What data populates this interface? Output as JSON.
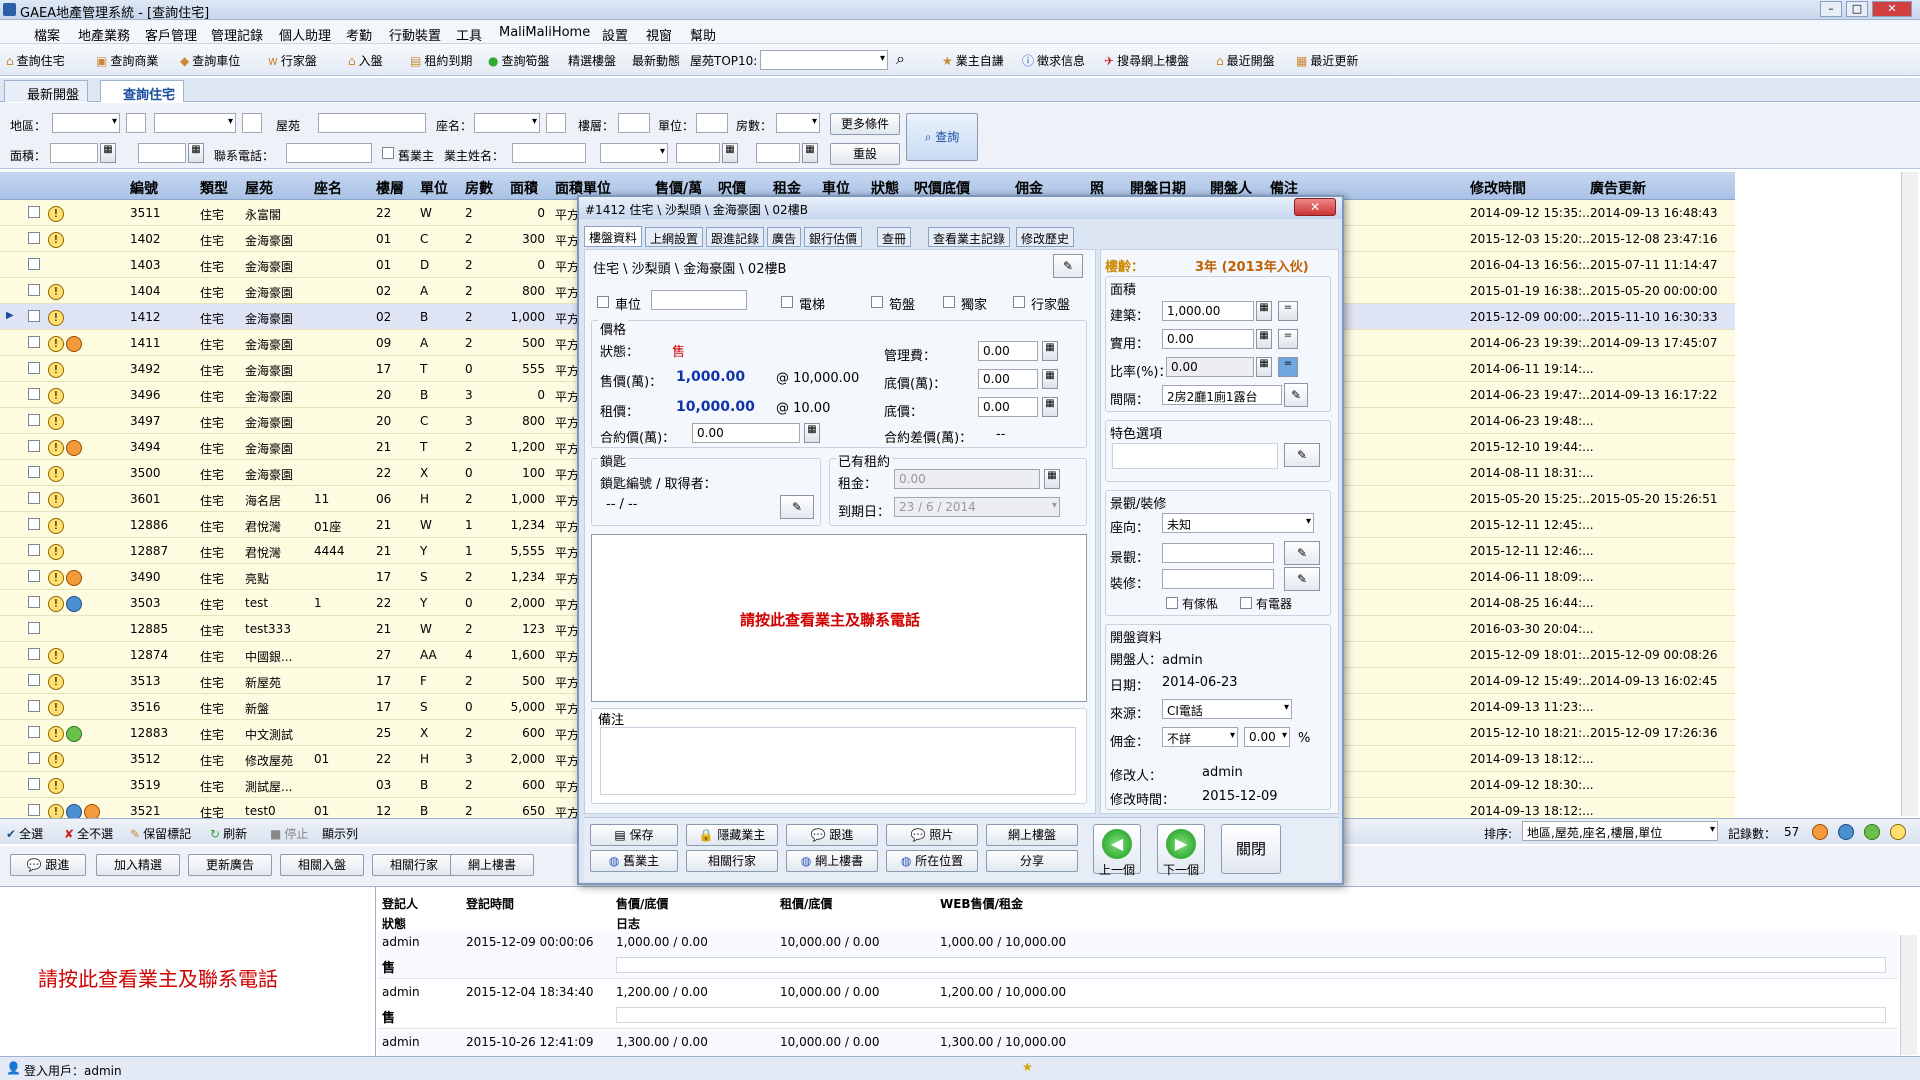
{
  "window": {
    "title": "GAEA地產管理系統 - [查詢住宅]"
  },
  "menu": [
    "檔案",
    "地產業務",
    "客戶管理",
    "管理記錄",
    "個人助理",
    "考勤",
    "行動裝置",
    "工具",
    "MaliMaliHome",
    "設置",
    "視窗",
    "幫助"
  ],
  "toolbar": [
    "查詢住宅",
    "查詢商業",
    "查詢車位",
    "行家盤",
    "入盤",
    "租約到期",
    "查詢筍盤",
    "精選樓盤",
    "最新動態",
    "屋苑TOP10:",
    "業主自謙",
    "徵求信息",
    "搜尋網上樓盤",
    "最近開盤",
    "最近更新"
  ],
  "tabs": [
    "最新開盤",
    "查詢住宅"
  ],
  "filter": {
    "area": "地區：",
    "estate": "屋苑",
    "block": "座名：",
    "floor": "樓層：",
    "unit": "單位：",
    "rooms": "房數：",
    "more": "更多條件",
    "search": "查詢",
    "size": "面積：",
    "owner_phone": "聯系電話：",
    "old_owner": "舊業主",
    "owner_name": "業主姓名：",
    "reset": "重設"
  },
  "grid": {
    "headers": [
      "編號",
      "類型",
      "屋苑",
      "座名",
      "樓層",
      "單位",
      "房數",
      "面積",
      "面積單位",
      "售價/萬",
      "呎價",
      "租金",
      "車位",
      "狀態",
      "呎價底價",
      "佣金",
      "照",
      "開盤日期",
      "開盤人",
      "備注",
      "修改時間",
      "廣告更新"
    ],
    "rows": [
      [
        "3511",
        "住宅",
        "永富閣",
        "",
        "22",
        "W",
        "2",
        "0",
        "平方",
        "2014-09-12 15:35:...",
        "2014-09-13 16:48:43"
      ],
      [
        "1402",
        "住宅",
        "金海豪園",
        "",
        "01",
        "C",
        "2",
        "300",
        "平方",
        "2015-12-03 15:20:...",
        "2015-12-08 23:47:16"
      ],
      [
        "1403",
        "住宅",
        "金海豪園",
        "",
        "01",
        "D",
        "2",
        "0",
        "平方",
        "2016-04-13 16:56:...",
        "2015-07-11 11:14:47"
      ],
      [
        "1404",
        "住宅",
        "金海豪園",
        "",
        "02",
        "A",
        "2",
        "800",
        "平方",
        "2015-01-19 16:38:...",
        "2015-05-20 00:00:00"
      ],
      [
        "1412",
        "住宅",
        "金海豪園",
        "",
        "02",
        "B",
        "2",
        "1,000",
        "平方",
        "2015-12-09 00:00:...",
        "2015-11-10 16:30:33"
      ],
      [
        "1411",
        "住宅",
        "金海豪園",
        "",
        "09",
        "A",
        "2",
        "500",
        "平方",
        "2014-06-23 19:39:...",
        "2014-09-13 17:45:07"
      ],
      [
        "3492",
        "住宅",
        "金海豪園",
        "",
        "17",
        "T",
        "0",
        "555",
        "平方",
        "2014-06-11 19:14:...",
        ""
      ],
      [
        "3496",
        "住宅",
        "金海豪園",
        "",
        "20",
        "B",
        "3",
        "0",
        "平方",
        "2014-06-23 19:47:...",
        "2014-09-13 16:17:22"
      ],
      [
        "3497",
        "住宅",
        "金海豪園",
        "",
        "20",
        "C",
        "3",
        "800",
        "平方",
        "2014-06-23 19:48:...",
        ""
      ],
      [
        "3494",
        "住宅",
        "金海豪園",
        "",
        "21",
        "T",
        "2",
        "1,200",
        "平方",
        "2015-12-10 19:44:...",
        ""
      ],
      [
        "3500",
        "住宅",
        "金海豪園",
        "",
        "22",
        "X",
        "0",
        "100",
        "平方",
        "2014-08-11 18:31:...",
        ""
      ],
      [
        "3601",
        "住宅",
        "海名居",
        "11",
        "06",
        "H",
        "2",
        "1,000",
        "平方",
        "2015-05-20 15:25:...",
        "2015-05-20 15:26:51"
      ],
      [
        "12886",
        "住宅",
        "君悅灣",
        "01座",
        "21",
        "W",
        "1",
        "1,234",
        "平方",
        "2015-12-11 12:45:...",
        ""
      ],
      [
        "12887",
        "住宅",
        "君悅灣",
        "4444",
        "21",
        "Y",
        "1",
        "5,555",
        "平方",
        "2015-12-11 12:46:...",
        ""
      ],
      [
        "3490",
        "住宅",
        "亮點",
        "",
        "17",
        "S",
        "2",
        "1,234",
        "平方",
        "2014-06-11 18:09:...",
        ""
      ],
      [
        "3503",
        "住宅",
        "test",
        "1",
        "22",
        "Y",
        "0",
        "2,000",
        "平方",
        "2014-08-25 16:44:...",
        ""
      ],
      [
        "12885",
        "住宅",
        "test333",
        "",
        "21",
        "W",
        "2",
        "123",
        "平方",
        "2016-03-30 20:04:...",
        ""
      ],
      [
        "12874",
        "住宅",
        "中國銀...",
        "",
        "27",
        "AA",
        "4",
        "1,600",
        "平方",
        "2015-12-09 18:01:...",
        "2015-12-09 00:08:26"
      ],
      [
        "3513",
        "住宅",
        "新屋苑",
        "",
        "17",
        "F",
        "2",
        "500",
        "平方",
        "2014-09-12 15:49:...",
        "2014-09-13 16:02:45"
      ],
      [
        "3516",
        "住宅",
        "新盤",
        "",
        "17",
        "S",
        "0",
        "5,000",
        "平方",
        "2014-09-13 11:23:...",
        ""
      ],
      [
        "12883",
        "住宅",
        "中文測試",
        "",
        "25",
        "X",
        "2",
        "600",
        "平方",
        "2015-12-10 18:21:...",
        "2015-12-09 17:26:36"
      ],
      [
        "3512",
        "住宅",
        "修改屋苑",
        "01",
        "22",
        "H",
        "3",
        "2,000",
        "平方",
        "2014-09-13 18:12:...",
        ""
      ],
      [
        "3519",
        "住宅",
        "測試屋...",
        "",
        "03",
        "B",
        "2",
        "600",
        "平方",
        "2014-09-12 18:30:...",
        ""
      ],
      [
        "3521",
        "住宅",
        "test0",
        "01",
        "12",
        "B",
        "2",
        "650",
        "平方",
        "2014-09-13 18:12:...",
        ""
      ]
    ]
  },
  "bottombar": {
    "select_all": "全選",
    "select_none": "全不選",
    "keep": "保留標記",
    "refresh": "刷新",
    "stop": "停止",
    "show": "顯示列",
    "sort_label": "排序:",
    "sort_value": "地區,屋苑,座名,樓層,單位",
    "count_label": "記錄數：",
    "count": "57"
  },
  "actions": [
    "跟進",
    "加入精選",
    "更新廣告",
    "相關入盤",
    "相關行家",
    "網上樓書"
  ],
  "lower": {
    "notice": "請按此查看業主及聯系電話",
    "cols": [
      "登記人",
      "登記時間",
      "售價/底價",
      "租價/底價",
      "WEB售價/租金"
    ],
    "sub": [
      "狀態",
      "日志"
    ],
    "rows": [
      [
        "admin",
        "2015-12-09 00:00:06",
        "1,000.00 / 0.00",
        "10,000.00 / 0.00",
        "1,000.00 / 10,000.00",
        "售"
      ],
      [
        "admin",
        "2015-12-04 18:34:40",
        "1,200.00 / 0.00",
        "10,000.00 / 0.00",
        "1,200.00 / 10,000.00",
        "售"
      ],
      [
        "admin",
        "2015-10-26 12:41:09",
        "1,300.00 / 0.00",
        "10,000.00 / 0.00",
        "1,300.00 / 10,000.00",
        ""
      ]
    ]
  },
  "status": {
    "user": "登入用戶：admin"
  },
  "dialog": {
    "title": "#1412 住宅 \\ 沙梨頭 \\ 金海豪園 \\ 02樓B",
    "close": "✕",
    "tabs": [
      "樓盤資料",
      "上網設置",
      "跟進記錄",
      "廣告",
      "銀行估價",
      "查冊",
      "查看業主記錄",
      "修改歷史"
    ],
    "path": "住宅 \\ 沙梨頭 \\ 金海豪園 \\ 02樓B",
    "checks": {
      "parking": "車位",
      "lift": "電梯",
      "bargain": "筍盤",
      "exclusive": "獨家",
      "agency": "行家盤"
    },
    "price": {
      "legend": "價格",
      "status_label": "狀態：",
      "status": "售",
      "sale_label": "售價(萬)：",
      "sale": "1,000.00",
      "sale_unit": "@ 10,000.00",
      "rent_label": "租價：",
      "rent": "10,000.00",
      "rent_unit": "@ 10.00",
      "contract_label": "合約價(萬)：",
      "contract": "0.00",
      "mgmt_label": "管理費：",
      "mgmt": "0.00",
      "floor_label": "底價(萬)：",
      "floor": "0.00",
      "floor2_label": "底價：",
      "floor2": "0.00",
      "diff_label": "合約差價(萬)：",
      "diff": "--"
    },
    "keys": {
      "legend": "鎖匙",
      "label": "鎖匙編號 / 取得者：",
      "value": "-- / --"
    },
    "lease": {
      "legend": "已有租約",
      "rent_label": "租金：",
      "rent": "0.00",
      "due_label": "到期日：",
      "due": "23 / 6 / 2014"
    },
    "notice": "請按此查看業主及聯系電話",
    "remark": "備注",
    "age_label": "樓齡：",
    "age": "3年 (2013年入伙)",
    "area": {
      "legend": "面積",
      "build_label": "建築：",
      "build": "1,000.00",
      "use_label": "實用：",
      "use": "0.00",
      "ratio_label": "比率(%)：",
      "ratio": "0.00",
      "layout_label": "間隔：",
      "layout": "2房2廳1廁1露台"
    },
    "feature": "特色選項",
    "view": {
      "legend": "景觀/裝修",
      "facing_label": "座向：",
      "facing": "未知",
      "view_label": "景觀：",
      "deco_label": "裝修：",
      "furniture": "有傢俬",
      "appliance": "有電器"
    },
    "open": {
      "legend": "開盤資料",
      "by": "開盤人：admin",
      "date_label": "日期：",
      "date": "2014-06-23",
      "src_label": "來源：",
      "src": "CI電話",
      "comm_label": "佣金：",
      "comm": "不詳",
      "comm2": "0.00",
      "pct": "%",
      "mod_by_label": "修改人：",
      "mod_by": "admin",
      "mod_time_label": "修改時間：",
      "mod_time": "2015-12-09"
    },
    "buttons": [
      "保存",
      "隱藏業主",
      "跟進",
      "照片",
      "網上樓盤",
      "舊業主",
      "相關行家",
      "網上樓書",
      "所在位置",
      "分享"
    ],
    "prev": "上一個",
    "next": "下一個",
    "closebtn": "關閉"
  }
}
